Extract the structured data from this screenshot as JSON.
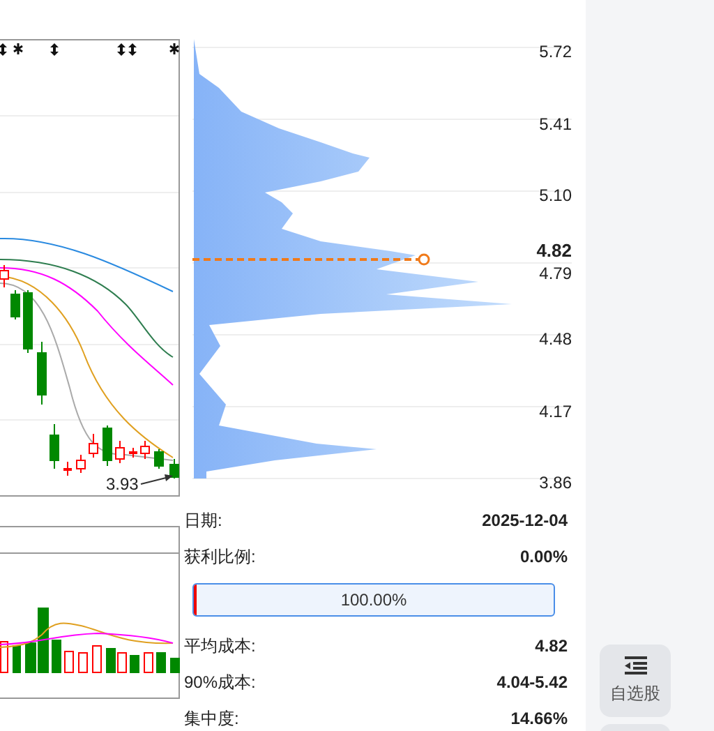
{
  "kline_chart": {
    "last_price_label": "3.93"
  },
  "chip_chart": {
    "price_axis": [
      "5.72",
      "5.41",
      "5.10",
      "4.79",
      "4.48",
      "4.17",
      "3.86"
    ],
    "average_cost_label": "4.82"
  },
  "info": [
    {
      "kind": "row",
      "label": "日期:",
      "value": "2025-12-04"
    },
    {
      "kind": "row",
      "label": "获利比例:",
      "value": "0.00%"
    },
    {
      "kind": "bar",
      "text": "100.00%",
      "level": 0
    },
    {
      "kind": "row",
      "label": "平均成本:",
      "value": "4.82"
    },
    {
      "kind": "row",
      "label": "90%成本:",
      "value": "4.04-5.42"
    },
    {
      "kind": "row",
      "label": "集中度:",
      "value": "14.66%"
    }
  ],
  "sidebar": {
    "buttons": [
      {
        "label": "自选股"
      }
    ]
  }
}
